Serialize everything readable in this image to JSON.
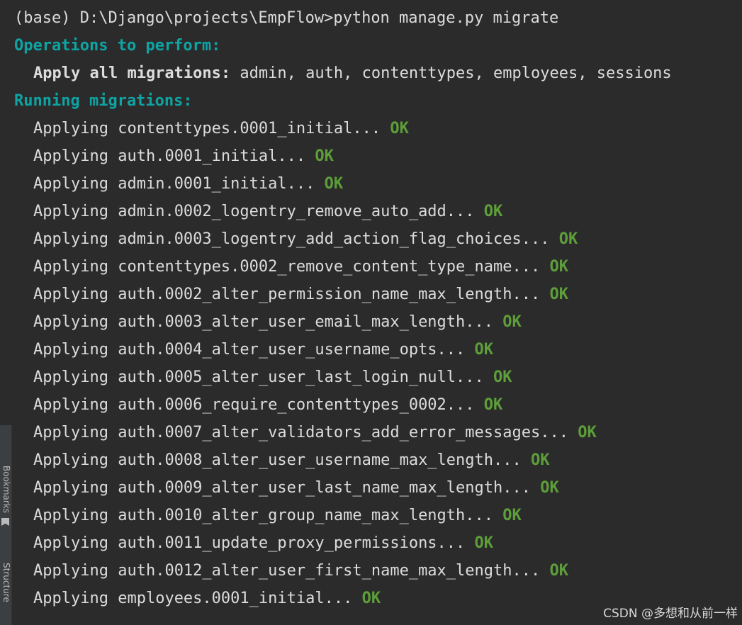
{
  "terminal": {
    "prompt": "(base) D:\\Django\\projects\\EmpFlow>python manage.py migrate",
    "operations_heading": "Operations to perform:",
    "apply_label": "Apply all migrations:",
    "apply_value": " admin, auth, contenttypes, employees, sessions",
    "running_heading": "Running migrations:",
    "applying_prefix": "Applying",
    "ok_text": "OK",
    "migrations": [
      "contenttypes.0001_initial...",
      "auth.0001_initial...",
      "admin.0001_initial...",
      "admin.0002_logentry_remove_auto_add...",
      "admin.0003_logentry_add_action_flag_choices...",
      "contenttypes.0002_remove_content_type_name...",
      "auth.0002_alter_permission_name_max_length...",
      "auth.0003_alter_user_email_max_length...",
      "auth.0004_alter_user_username_opts...",
      "auth.0005_alter_user_last_login_null...",
      "auth.0006_require_contenttypes_0002...",
      "auth.0007_alter_validators_add_error_messages...",
      "auth.0008_alter_user_username_max_length...",
      "auth.0009_alter_user_last_name_max_length...",
      "auth.0010_alter_group_name_max_length...",
      "auth.0011_update_proxy_permissions...",
      "auth.0012_alter_user_first_name_max_length...",
      "employees.0001_initial..."
    ]
  },
  "side_tabs": {
    "bookmarks": "Bookmarks",
    "structure": "Structure"
  },
  "watermark": "CSDN @多想和从前一样",
  "colors": {
    "background": "#2b2b2b",
    "heading": "#0fa3a3",
    "ok": "#5d9e3a",
    "text": "#dcdcdc"
  }
}
